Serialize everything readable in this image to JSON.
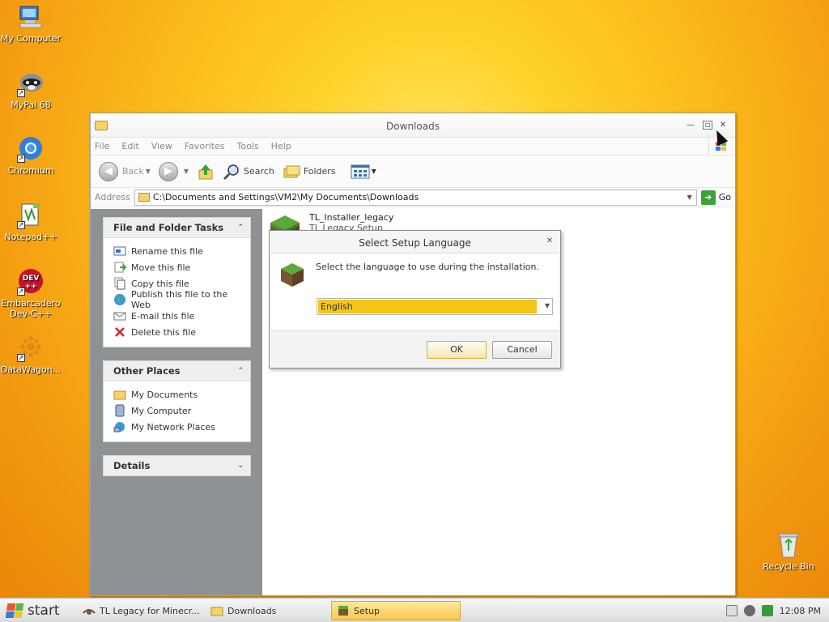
{
  "desktop": {
    "icons": [
      {
        "label": "My Computer",
        "icon": "computer-icon"
      },
      {
        "label": "MyPal 68",
        "icon": "mypal-icon"
      },
      {
        "label": "Chromium",
        "icon": "chromium-icon"
      },
      {
        "label": "Notepad++",
        "icon": "notepadpp-icon"
      },
      {
        "label": "Embarcadero Dev-C++",
        "icon": "devcpp-icon",
        "badge": "DEV\n++"
      },
      {
        "label": "DataWagon...",
        "icon": "datawagon-icon"
      }
    ],
    "recycle_bin": "Recycle Bin"
  },
  "explorer": {
    "title": "Downloads",
    "menu": [
      "File",
      "Edit",
      "View",
      "Favorites",
      "Tools",
      "Help"
    ],
    "toolbar": {
      "back": "Back",
      "search": "Search",
      "folders": "Folders"
    },
    "address_label": "Address",
    "address": "C:\\Documents and Settings\\VM2\\My Documents\\Downloads",
    "go": "Go",
    "file_tasks": {
      "title": "File and Folder Tasks",
      "items": [
        "Rename this file",
        "Move this file",
        "Copy this file",
        "Publish this file to the Web",
        "E-mail this file",
        "Delete this file"
      ]
    },
    "other_places": {
      "title": "Other Places",
      "items": [
        "My Documents",
        "My Computer",
        "My Network Places"
      ]
    },
    "details": {
      "title": "Details"
    },
    "file": {
      "name": "TL_Installer_legacy",
      "desc": "TL Legacy Setup"
    }
  },
  "dialog": {
    "title": "Select Setup Language",
    "message": "Select the language to use during the installation.",
    "selected_language": "English",
    "ok": "OK",
    "cancel": "Cancel"
  },
  "taskbar": {
    "start": "start",
    "items": [
      {
        "label": "TL Legacy for Minecr...",
        "active": false
      },
      {
        "label": "Downloads",
        "active": false
      },
      {
        "label": "Setup",
        "active": true
      }
    ],
    "clock": "12:08 PM"
  },
  "colors": {
    "selection": "#f5c518",
    "taskbar_active": "#f8c74a",
    "window_pane": "#8f9294"
  }
}
